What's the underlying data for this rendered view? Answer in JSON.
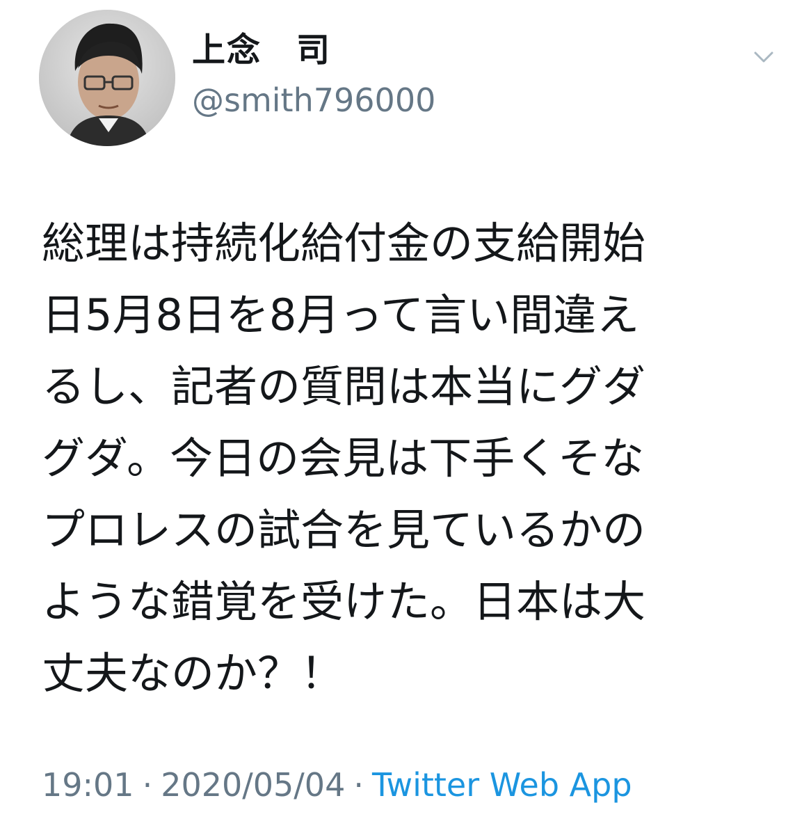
{
  "user": {
    "display_name": "上念　司",
    "handle": "@smith796000"
  },
  "tweet": {
    "text_lines": [
      "総理は持続化給付金の支給開始",
      "日5月8日を8月って言い間違え",
      "るし、記者の質問は本当にグダ",
      "グダ。今日の会見は下手くそな",
      "プロレスの試合を見ているかの",
      "ような錯覚を受けた。日本は大",
      "丈夫なのか？！"
    ],
    "time": "19:01",
    "date": "2020/05/04",
    "separator": "·",
    "source": "Twitter Web App"
  },
  "icons": {
    "menu": "chevron-down-icon",
    "avatar": "avatar-photo"
  },
  "colors": {
    "text": "#14171a",
    "secondary": "#657786",
    "link": "#1b95e0",
    "background": "#ffffff"
  }
}
